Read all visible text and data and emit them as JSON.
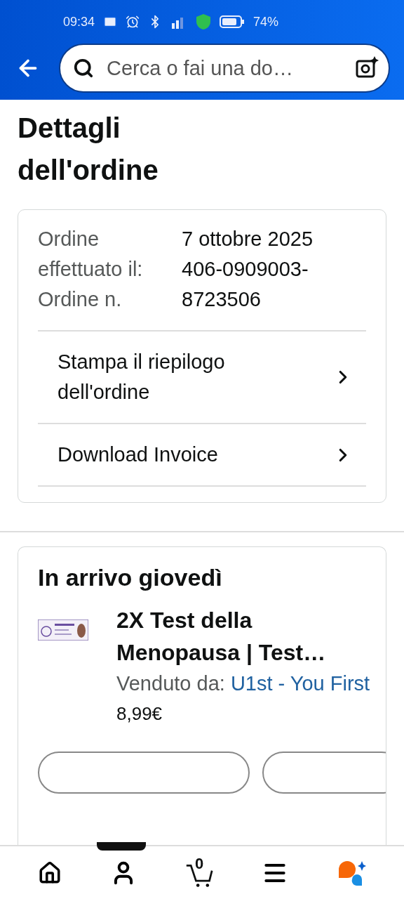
{
  "status_bar": {
    "time": "09:34",
    "battery": "74%"
  },
  "search": {
    "placeholder": "Cerca o fai una do…"
  },
  "page_title": "Dettagli dell'ordine",
  "order_info": {
    "labels": [
      "Ordine effettuato il:",
      "Ordine n."
    ],
    "values": [
      "7 ottobre 2025",
      "406-0909003-8723506"
    ]
  },
  "links": [
    "Stampa il riepilogo dell'ordine",
    "Download Invoice"
  ],
  "shipment": {
    "title": "In arrivo giovedì",
    "product": {
      "name": "2X Test della Menopausa | Test…",
      "seller_label": "Venduto da:",
      "seller": "U1st - You First",
      "price": "8,99€"
    }
  },
  "nav": {
    "items": [
      {
        "kind": "home"
      },
      {
        "kind": "account"
      },
      {
        "kind": "cart",
        "count": "0"
      },
      {
        "kind": "menu"
      },
      {
        "kind": "assistant"
      }
    ]
  }
}
